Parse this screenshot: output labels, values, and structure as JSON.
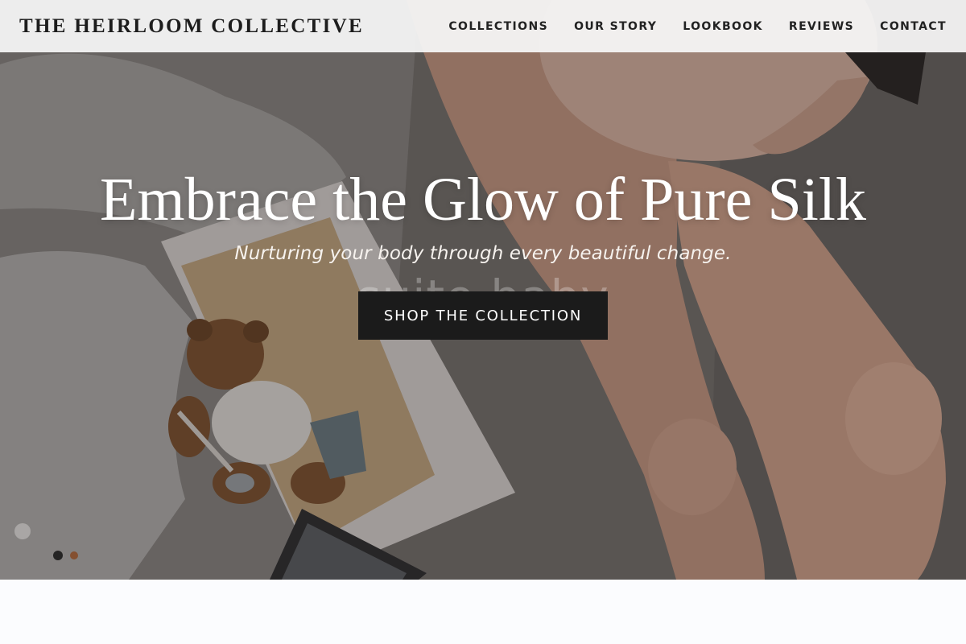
{
  "header": {
    "brand": "THE HEIRLOOM COLLECTIVE",
    "nav": [
      {
        "label": "COLLECTIONS"
      },
      {
        "label": "OUR STORY"
      },
      {
        "label": "LOOKBOOK"
      },
      {
        "label": "REVIEWS"
      },
      {
        "label": "CONTACT"
      }
    ]
  },
  "hero": {
    "title": "Embrace the Glow of Pure Silk",
    "subtitle": "Nurturing your body through every beautiful change.",
    "cta_label": "SHOP THE COLLECTION",
    "watermark": "suite.baby"
  },
  "colors": {
    "header_bg": "#f8f8f8",
    "cta_bg": "#1b1b1b",
    "text_dark": "#1c1c1c",
    "hero_text": "#ffffff"
  }
}
